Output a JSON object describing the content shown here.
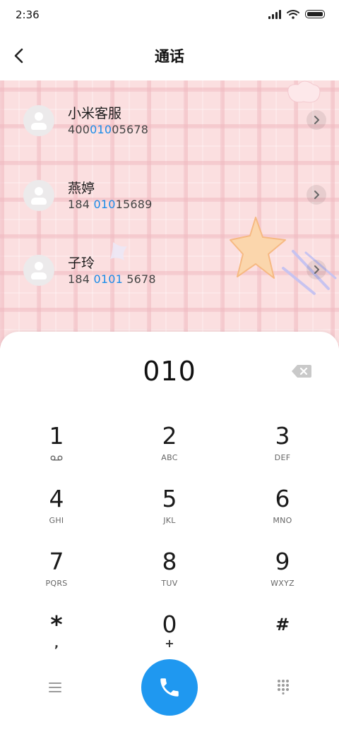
{
  "status_bar": {
    "time": "2:36"
  },
  "header": {
    "title": "通话"
  },
  "contacts": [
    {
      "name": "小米客服",
      "number_pre": "400",
      "number_match": "010",
      "number_post": "05678"
    },
    {
      "name": "燕婷",
      "number_pre": "184 ",
      "number_match": "010",
      "number_post": "15689"
    },
    {
      "name": "子玲",
      "number_pre": "184 ",
      "number_match": "0101",
      "number_post": " 5678"
    }
  ],
  "dialer": {
    "input_value": "010",
    "keys": [
      {
        "digit": "1",
        "letters": ""
      },
      {
        "digit": "2",
        "letters": "ABC"
      },
      {
        "digit": "3",
        "letters": "DEF"
      },
      {
        "digit": "4",
        "letters": "GHI"
      },
      {
        "digit": "5",
        "letters": "JKL"
      },
      {
        "digit": "6",
        "letters": "MNO"
      },
      {
        "digit": "7",
        "letters": "PQRS"
      },
      {
        "digit": "8",
        "letters": "TUV"
      },
      {
        "digit": "9",
        "letters": "WXYZ"
      },
      {
        "digit": "*",
        "letters": ","
      },
      {
        "digit": "0",
        "letters": "+"
      },
      {
        "digit": "#",
        "letters": ""
      }
    ]
  },
  "icons": {
    "back": "back-arrow-icon",
    "voicemail": "voicemail-icon",
    "backspace": "backspace-icon",
    "menu": "menu-icon",
    "call": "phone-icon",
    "keypad": "dialpad-icon",
    "chevron": "chevron-right-icon"
  },
  "colors": {
    "accent": "#1f98f0",
    "match_highlight": "#1a8ce8",
    "list_background": "#fbdfe0"
  }
}
